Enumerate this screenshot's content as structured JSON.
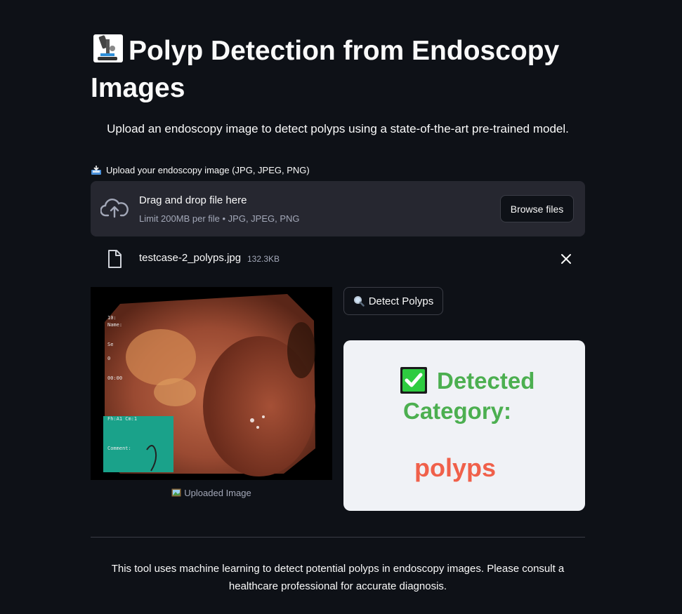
{
  "page": {
    "title": "Polyp Detection from Endoscopy Images",
    "subtitle": "Upload an endoscopy image to detect polyps using a state-of-the-art pre-trained model."
  },
  "uploader": {
    "label": "Upload your endoscopy image (JPG, JPEG, PNG)",
    "drop_text": "Drag and drop file here",
    "limit_text": "Limit 200MB per file • JPG, JPEG, PNG",
    "browse_label": "Browse files"
  },
  "file": {
    "name": "testcase-2_polyps.jpg",
    "size": "132.3KB"
  },
  "image": {
    "caption": "Uploaded Image"
  },
  "actions": {
    "detect_label": "Detect Polyps"
  },
  "result": {
    "label": "Detected Category:",
    "value": "polyps"
  },
  "footer": {
    "text": "This tool uses machine learning to detect potential polyps in endoscopy images. Please consult a healthcare professional for accurate diagnosis."
  },
  "icons": {
    "title": "microscope-icon",
    "upload_label": "inbox-tray-icon",
    "dropzone": "cloud-upload-icon",
    "file": "file-icon",
    "remove": "close-icon",
    "caption": "framed-picture-icon",
    "detect": "magnifier-icon",
    "result": "check-mark-icon"
  },
  "colors": {
    "background": "#0e1117",
    "dropzone": "#262730",
    "card": "#f0f2f6",
    "success": "#4caf50",
    "result_value": "#f0604a"
  }
}
